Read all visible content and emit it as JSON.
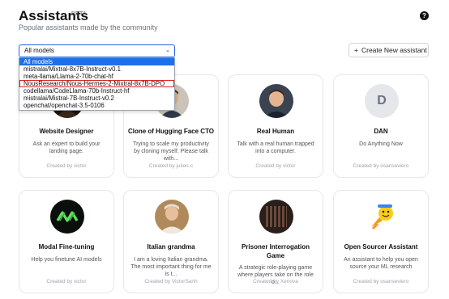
{
  "header": {
    "title": "Assistants",
    "beta": "BETA",
    "subtitle": "Popular assistants made by the community",
    "help_glyph": "?"
  },
  "filter": {
    "selected": "All models",
    "options": [
      "All models",
      "mistralai/Mixtral-8x7B-Instruct-v0.1",
      "meta-llama/Llama-2-70b-chat-hf",
      "NousResearch/Nous-Hermes-2-Mixtral-8x7B-DPO",
      "codellama/CodeLlama-70b-Instruct-hf",
      "mistralai/Mistral-7B-Instruct-v0.2",
      "openchat/openchat-3.5-0106"
    ],
    "highlighted_index": 3
  },
  "new_button": {
    "label": "Create New assistant",
    "icon": "plus-icon"
  },
  "cards": [
    {
      "name": "Website Designer",
      "desc": "Ask an expert to build your landing page.",
      "by": "Created by victor",
      "avatar": "dark-figure"
    },
    {
      "name": "Clone of Hugging Face CTO",
      "desc": "Trying to scale my productivity by cloning myself. Please talk with...",
      "by": "Created by julien-c",
      "avatar": "portrait"
    },
    {
      "name": "Real Human",
      "desc": "Talk with a real human trapped into a computer.",
      "by": "Created by victor",
      "avatar": "portrait"
    },
    {
      "name": "DAN",
      "desc": "Do Anything Now",
      "by": "Created by osanseviero",
      "avatar": "letter-D",
      "letter": "D"
    },
    {
      "name": "Modal Fine-tuning",
      "desc": "Help you finetune AI models",
      "by": "Created by victor",
      "avatar": "modal-logo"
    },
    {
      "name": "Italian grandma",
      "desc": "I am a loving Italian grandma. The most important thing for me is t...",
      "by": "Created by VictorSanh",
      "avatar": "portrait"
    },
    {
      "name": "Prisoner Interrogation Game",
      "desc": "A strategic role-playing game where players take on the role o...",
      "by": "Created by Xenova",
      "avatar": "prison-cell"
    },
    {
      "name": "Open Sourcer Assistant",
      "desc": "An assistant to help you open source your ML research",
      "by": "Created by osanseviero",
      "avatar": "hugging-rocket"
    }
  ],
  "colors": {
    "accent": "#2563eb",
    "highlight": "#dc2626",
    "selected_option": "#1e6fe8"
  }
}
